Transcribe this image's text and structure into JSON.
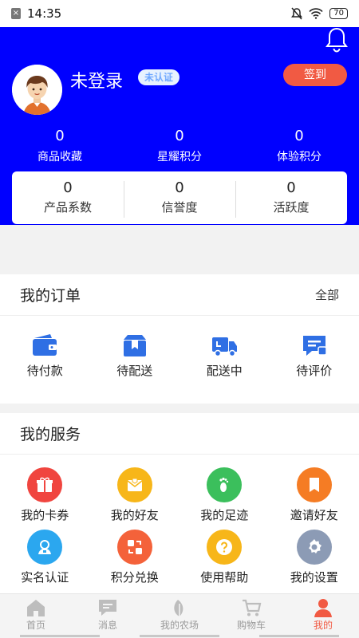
{
  "status_bar": {
    "time": "14:35",
    "battery": "70"
  },
  "profile": {
    "username": "未登录",
    "auth_badge": "未认证",
    "signin_label": "签到"
  },
  "stats": [
    {
      "value": "0",
      "label": "商品收藏"
    },
    {
      "value": "0",
      "label": "星耀积分"
    },
    {
      "value": "0",
      "label": "体验积分"
    }
  ],
  "card_stats": [
    {
      "value": "0",
      "label": "产品系数"
    },
    {
      "value": "0",
      "label": "信誉度"
    },
    {
      "value": "0",
      "label": "活跃度"
    }
  ],
  "orders": {
    "title": "我的订单",
    "all_label": "全部",
    "items": [
      {
        "label": "待付款",
        "icon": "wallet-icon"
      },
      {
        "label": "待配送",
        "icon": "package-icon"
      },
      {
        "label": "配送中",
        "icon": "truck-icon"
      },
      {
        "label": "待评价",
        "icon": "review-icon"
      }
    ]
  },
  "services": {
    "title": "我的服务",
    "items": [
      {
        "label": "我的卡券",
        "icon": "gift-icon",
        "color": "#f0453f"
      },
      {
        "label": "我的好友",
        "icon": "envelope-icon",
        "color": "#f7b619"
      },
      {
        "label": "我的足迹",
        "icon": "footprint-icon",
        "color": "#3bbf5c"
      },
      {
        "label": "邀请好友",
        "icon": "bookmark-icon",
        "color": "#f57c24"
      },
      {
        "label": "实名认证",
        "icon": "user-badge-icon",
        "color": "#2ba7ef"
      },
      {
        "label": "积分兑换",
        "icon": "exchange-icon",
        "color": "#f4623a"
      },
      {
        "label": "使用帮助",
        "icon": "help-icon",
        "color": "#f7b619"
      },
      {
        "label": "我的设置",
        "icon": "gear-icon",
        "color": "#8c9bb5"
      }
    ]
  },
  "tabs": [
    {
      "label": "首页",
      "icon": "home-icon"
    },
    {
      "label": "消息",
      "icon": "message-icon"
    },
    {
      "label": "我的农场",
      "icon": "leaf-icon"
    },
    {
      "label": "购物车",
      "icon": "cart-icon"
    },
    {
      "label": "我的",
      "icon": "person-icon"
    }
  ],
  "colors": {
    "header": "#0000ff",
    "accent": "#f15a43",
    "order_icon": "#2f6fe4"
  }
}
